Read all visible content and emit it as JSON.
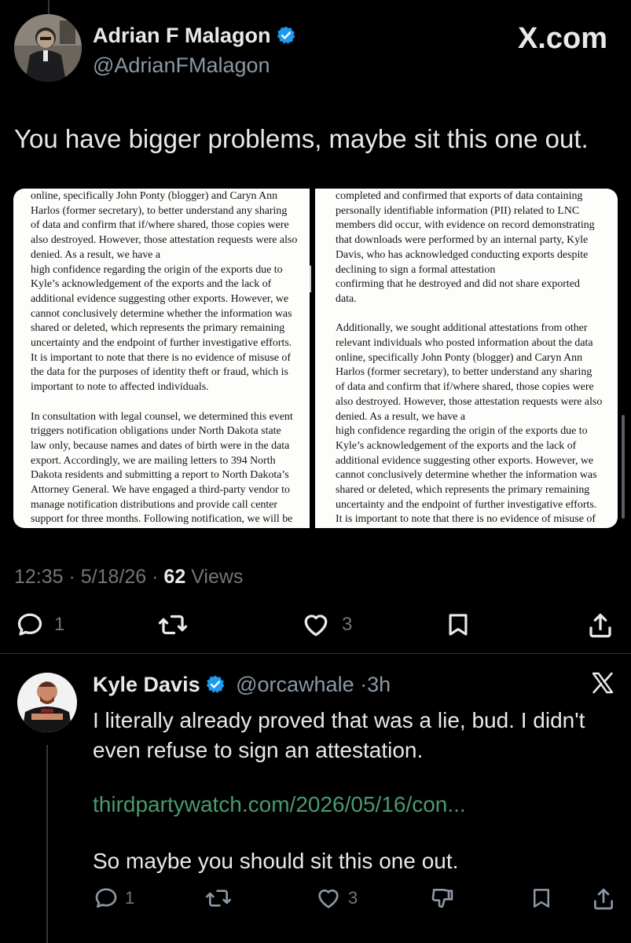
{
  "main_tweet": {
    "author_name": "Adrian F Malagon",
    "author_handle": "@AdrianFMalagon",
    "watermark": "X.com",
    "text": "You have bigger problems, maybe sit this one out.",
    "time": "12:35",
    "date": "5/18/26",
    "views_count": "62",
    "views_label": "Views",
    "actions": {
      "replies": "1",
      "likes": "3"
    }
  },
  "document": {
    "left_lines": [
      "online, specifically John Ponty (blogger) and Caryn Ann",
      "Harlos (former secretary), to better understand any sharing",
      "of data and confirm that if/where shared, those copies were",
      "also destroyed. However, those attestation requests were also",
      "denied. As a result, we have a",
      "high confidence regarding the origin of the exports due to",
      "Kyle’s acknowledgement of the exports and the lack of",
      "additional evidence suggesting other exports. However, we",
      "cannot conclusively determine whether the information was",
      "shared or deleted, which represents the primary remaining",
      "uncertainty and the endpoint of further investigative efforts.",
      "It is important to note that there is no evidence of misuse of",
      "the data for the purposes of identity theft or fraud, which is",
      "important to note to affected individuals.",
      "",
      "In consultation with legal counsel, we determined this event",
      "triggers notification obligations under North Dakota state",
      "law only, because names and dates of birth were in the data",
      "export. Accordingly, we are mailing letters to 394 North",
      "Dakota residents and submitting a report to North Dakota’s",
      "Attorney General. We have engaged a third-party vendor to",
      "manage notification distributions and provide call center",
      "support for three months. Following notification, we will be"
    ],
    "right_lines": [
      "completed and confirmed that exports of data containing",
      "personally identifiable information (PII) related to LNC",
      "members did occur, with evidence on record demonstrating",
      "that downloads were performed by an internal party, Kyle",
      "Davis, who has acknowledged conducting exports despite",
      "declining to sign a formal attestation",
      "confirming that he destroyed and did not share exported",
      "data.",
      "",
      "Additionally, we sought additional attestations from other",
      "relevant individuals who posted information about the data",
      "online, specifically John Ponty (blogger) and Caryn Ann",
      "Harlos (former secretary), to better understand any sharing",
      "of data and confirm that if/where shared, those copies were",
      "also destroyed. However, those attestation requests were also",
      "denied. As a result, we have a",
      "high confidence regarding the origin of the exports due to",
      "Kyle’s acknowledgement of the exports and the lack of",
      "additional evidence suggesting other exports. However, we",
      "cannot conclusively determine whether the information was",
      "shared or deleted, which represents the primary remaining",
      "uncertainty and the endpoint of further investigative efforts.",
      "It is important to note that there is no evidence of misuse of"
    ]
  },
  "reply": {
    "author_name": "Kyle Davis",
    "author_handle": "@orcawhale",
    "separator": "·",
    "age": "3h",
    "text_line1": "I literally already proved that was a lie, bud. I didn't even refuse to sign an attestation.",
    "link": "thirdpartywatch.com/2026/05/16/con...",
    "text_line2": "So maybe you should sit this one out.",
    "actions": {
      "replies": "1",
      "likes": "3"
    }
  },
  "colors": {
    "background": "#000000",
    "text": "#e7e9ea",
    "muted": "#71767b",
    "verified": "#1d9bf0",
    "link": "#4a9a6d"
  },
  "icons": [
    "verified-badge-icon",
    "reply-icon",
    "repost-icon",
    "like-icon",
    "bookmark-icon",
    "share-icon",
    "dislike-icon",
    "x-logo-icon"
  ]
}
